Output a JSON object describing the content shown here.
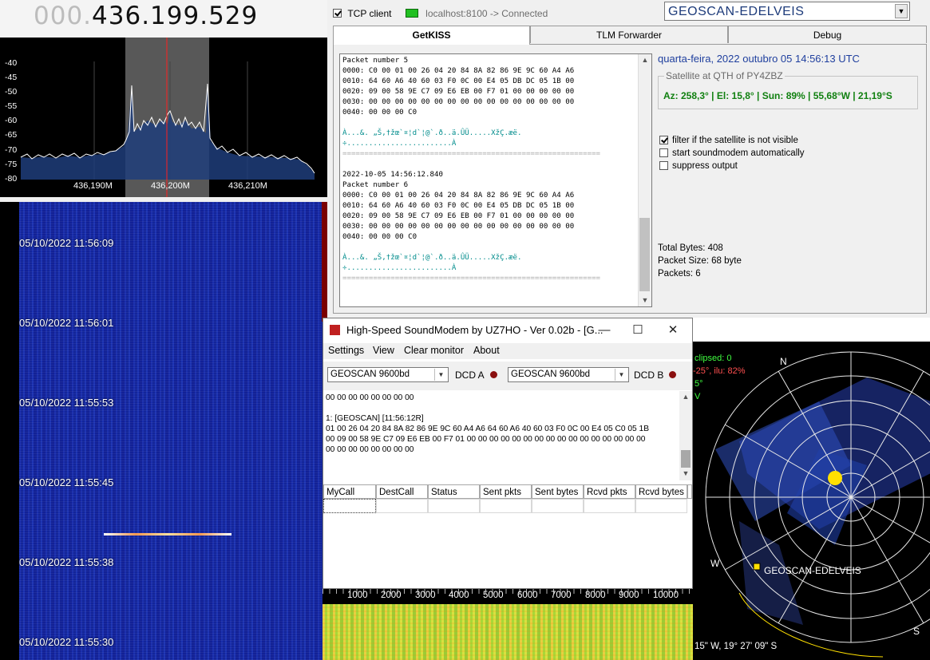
{
  "sdr": {
    "freq_dim": "000.",
    "freq_main": "436.199.529",
    "spectrum": {
      "y_ticks": [
        "-40",
        "-45",
        "-50",
        "-55",
        "-60",
        "-65",
        "-70",
        "-75",
        "-80"
      ],
      "x_ticks": [
        "436,190M",
        "436,200M",
        "436,210M"
      ]
    },
    "waterfall_times": [
      "05/10/2022 11:56:09",
      "05/10/2022 11:56:01",
      "05/10/2022 11:55:53",
      "05/10/2022 11:55:45",
      "05/10/2022 11:55:38",
      "05/10/2022 11:55:30"
    ]
  },
  "kiss": {
    "tcp_label": "TCP client",
    "tcp_checked": true,
    "connection": "localhost:8100 -> Connected",
    "satellite": "GEOSCAN-EDELVEIS",
    "tabs": [
      "GetKISS",
      "TLM Forwarder",
      "Debug"
    ],
    "log": {
      "p5_title": "Packet number 5",
      "p5_rows": [
        "0000: C0 00 01 00 26 04 20 84 8A 82 86 9E 9C 60 A4 A6",
        "0010: 64 60 A6 40 60 03 F0 0C 00 E4 05 DB DC 05 1B 00",
        "0020: 09 00 58 9E C7 09 E6 EB 00 F7 01 00 00 00 00 00",
        "0030: 00 00 00 00 00 00 00 00 00 00 00 00 00 00 00 00",
        "0040: 00 00 00 C0"
      ],
      "p5_ascii1": "À...&. „Š,†žœ`¤¦d`¦@`.ð..ä.ÛÜ.....XžÇ.æë.",
      "p5_ascii2": "÷........................À",
      "separator": "===========================================================",
      "p6_timestamp": "2022-10-05 14:56:12.840",
      "p6_title": "Packet number 6",
      "p6_rows": [
        "0000: C0 00 01 00 26 04 20 84 8A 82 86 9E 9C 60 A4 A6",
        "0010: 64 60 A6 40 60 03 F0 0C 00 E4 05 DB DC 05 1B 00",
        "0020: 09 00 58 9E C7 09 E6 EB 00 F7 01 00 00 00 00 00",
        "0030: 00 00 00 00 00 00 00 00 00 00 00 00 00 00 00 00",
        "0040: 00 00 00 C0"
      ],
      "p6_ascii1": "À...&. „Š,†žœ`¤¦d`¦@`.ð..ä.ÛÜ.....XžÇ.æë.",
      "p6_ascii2": "÷........................À"
    },
    "date_time": "quarta-feira, 2022 outubro 05  14:56:13 UTC",
    "qth_legend": "Satellite at QTH of PY4ZBZ",
    "qth_values": "Az: 258,3° | El: 15,8° | Sun: 89% | 55,68°W | 21,19°S",
    "options": [
      {
        "label": "filter if the satellite is not visible",
        "checked": true
      },
      {
        "label": "start soundmodem automatically",
        "checked": false
      },
      {
        "label": "suppress output",
        "checked": false
      }
    ],
    "stats": {
      "total_bytes": "Total Bytes: 408",
      "packet_size": "Packet Size: 68 byte",
      "packets": "Packets: 6"
    }
  },
  "soundmodem": {
    "title": "High-Speed SoundModem by UZ7HO - Ver 0.02b - [G...",
    "menu": [
      "Settings",
      "View",
      "Clear monitor",
      "About"
    ],
    "modem_a": "GEOSCAN 9600bd",
    "modem_b": "GEOSCAN 9600bd",
    "dcd_a": "DCD A",
    "dcd_b": "DCD B",
    "monitor_lines": [
      "00 00 00 00 00 00 00 00",
      "",
      "1: [GEOSCAN] [11:56:12R]",
      "01 00 26 04 20 84 8A 82 86 9E 9C 60 A4 A6 64 60 A6 40 60 03 F0 0C 00 E4 05 C0 05 1B",
      "00 09 00 58 9E C7 09 E6 EB 00 F7 01 00 00 00 00 00 00 00 00 00 00 00 00 00 00 00 00",
      "00 00 00 00 00 00 00 00"
    ],
    "table_headers": [
      "MyCall",
      "DestCall",
      "Status",
      "Sent pkts",
      "Sent bytes",
      "Rcvd pkts",
      "Rcvd bytes"
    ],
    "audio_ticks": [
      "1000",
      "2000",
      "3000",
      "4000",
      "5000",
      "6000",
      "7000",
      "8000",
      "9000",
      "10000"
    ]
  },
  "polar": {
    "text_eclipsed": "clipsed: 0",
    "text_moon": "-25°, ilu: 82%",
    "text_partial1": "5°",
    "text_partial2": "V",
    "north": "N",
    "south": "S",
    "west": "W",
    "sat_label": "GEOSCAN-EDELVEIS",
    "coords": "15\" W, 19° 27' 09\" S"
  },
  "colors": {
    "date_blue": "#1f3f9e",
    "qth_green": "#108010",
    "log_teal": "#008c8c",
    "sat_yellow": "#ffe000",
    "waterfall_blue": "#15269a"
  }
}
